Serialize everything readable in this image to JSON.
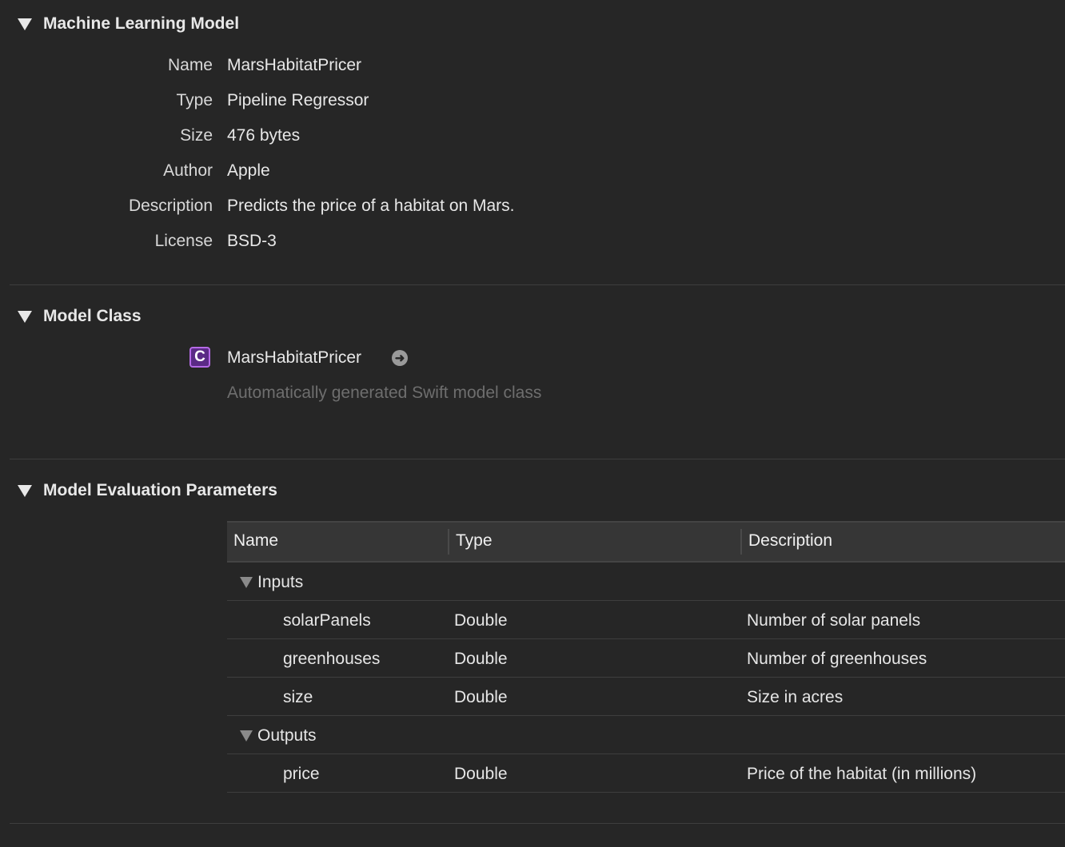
{
  "sections": {
    "ml_model": {
      "title": "Machine Learning Model",
      "fields": [
        {
          "label": "Name",
          "value": "MarsHabitatPricer"
        },
        {
          "label": "Type",
          "value": "Pipeline Regressor"
        },
        {
          "label": "Size",
          "value": "476 bytes"
        },
        {
          "label": "Author",
          "value": "Apple"
        },
        {
          "label": "Description",
          "value": "Predicts the price of a habitat on Mars."
        },
        {
          "label": "License",
          "value": "BSD-3"
        }
      ]
    },
    "model_class": {
      "title": "Model Class",
      "class_icon": "C",
      "class_name": "MarsHabitatPricer",
      "subtitle": "Automatically generated Swift model class"
    },
    "eval_params": {
      "title": "Model Evaluation Parameters",
      "columns": [
        "Name",
        "Type",
        "Description"
      ],
      "inputs_label": "Inputs",
      "inputs": [
        {
          "name": "solarPanels",
          "type": "Double",
          "description": "Number of solar panels"
        },
        {
          "name": "greenhouses",
          "type": "Double",
          "description": "Number of greenhouses"
        },
        {
          "name": "size",
          "type": "Double",
          "description": "Size in acres"
        }
      ],
      "outputs_label": "Outputs",
      "outputs": [
        {
          "name": "price",
          "type": "Double",
          "description": "Price of the habitat (in millions)"
        }
      ]
    }
  }
}
